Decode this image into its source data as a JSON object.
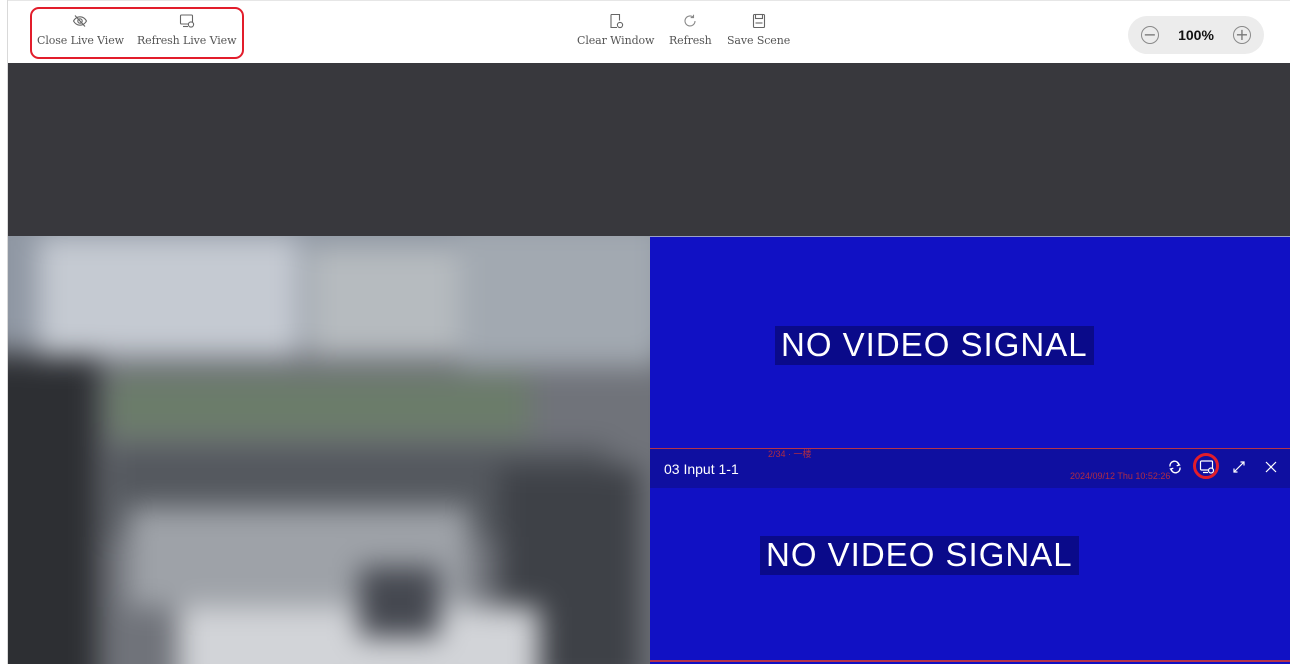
{
  "toolbar": {
    "close_live_view": "Close Live View",
    "refresh_live_view": "Refresh Live View",
    "clear_window": "Clear Window",
    "refresh": "Refresh",
    "save_scene": "Save Scene",
    "zoom_level": "100%",
    "zoom_out": "−",
    "zoom_in": "+"
  },
  "windows": {
    "top_right": {
      "message": "NO VIDEO SIGNAL"
    },
    "bottom_right": {
      "title": "03 Input 1-1",
      "message": "NO VIDEO SIGNAL",
      "osd_top": "2/34 · 一楼",
      "osd_time": "2024/09/12 Thu 10:52:26",
      "icons": [
        "switch-icon",
        "refresh-live-view-icon",
        "fullscreen-icon",
        "close-icon"
      ]
    }
  },
  "colors": {
    "accent_red": "#e21d2b",
    "signal_blue": "#1111c4",
    "dark_bg": "#38383d"
  }
}
